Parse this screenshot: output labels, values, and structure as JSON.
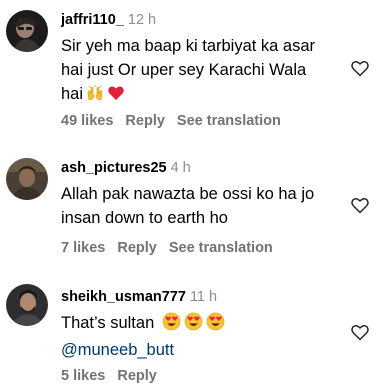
{
  "comments": [
    {
      "username": "jaffri110_",
      "time": "12 h",
      "text_line1": "Sir yeh ma baap ki tarbiyat ka asar",
      "text_line2": "hai just Or uper sey Karachi Wala",
      "text_line3": "hai",
      "emojis": [
        "raising-hands-emoji",
        "red-heart-emoji"
      ],
      "likes": "49 likes",
      "reply": "Reply",
      "translation": "See translation"
    },
    {
      "username": "ash_pictures25",
      "time": "4 h",
      "text_line1": "Allah pak nawazta be ossi ko ha jo",
      "text_line2": "insan down to earth ho",
      "likes": "7 likes",
      "reply": "Reply",
      "translation": "See translation"
    },
    {
      "username": "sheikh_usman777",
      "time": "11 h",
      "text_line1": "That’s sultan",
      "emojis": [
        "heart-eyes-emoji",
        "heart-eyes-emoji",
        "heart-eyes-emoji"
      ],
      "mention": "@muneeb_butt",
      "likes": "5 likes",
      "reply": "Reply"
    }
  ],
  "colors": {
    "text": "#000000",
    "secondary": "#737373",
    "time": "#8e8e8e",
    "mention": "#00376b",
    "heart_outline": "#262626"
  },
  "icons": {
    "like": "heart-outline-icon"
  }
}
